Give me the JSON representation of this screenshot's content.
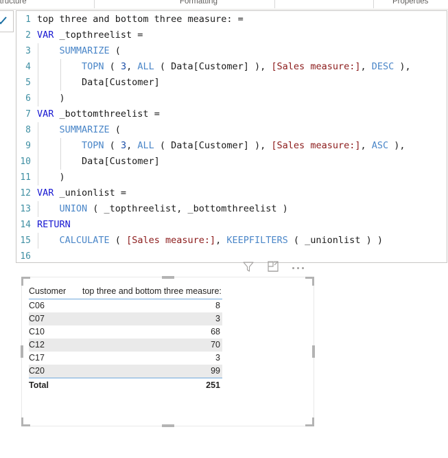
{
  "ribbon": {
    "groups": [
      {
        "name": "structure",
        "label": "Structure"
      },
      {
        "name": "formatting",
        "label": "Formatting"
      },
      {
        "name": "properties",
        "label": "Properties"
      }
    ]
  },
  "formula_bar": {
    "commit_icon": "checkmark-icon",
    "measure_name": "top three and bottom three measure:",
    "lines": [
      {
        "number": "1",
        "indent": 0,
        "tokens": [
          {
            "type": "plain",
            "text": "top three and bottom three measure: ="
          }
        ]
      },
      {
        "number": "2",
        "indent": 0,
        "tokens": [
          {
            "type": "kw",
            "text": "VAR"
          },
          {
            "type": "plain",
            "text": " _topthreelist ="
          }
        ]
      },
      {
        "number": "3",
        "indent": 1,
        "tokens": [
          {
            "type": "plain",
            "text": "    "
          },
          {
            "type": "fn",
            "text": "SUMMARIZE"
          },
          {
            "type": "plain",
            "text": " ("
          }
        ]
      },
      {
        "number": "4",
        "indent": 2,
        "tokens": [
          {
            "type": "plain",
            "text": "        "
          },
          {
            "type": "fn",
            "text": "TOPN"
          },
          {
            "type": "plain",
            "text": " ( "
          },
          {
            "type": "num",
            "text": "3"
          },
          {
            "type": "plain",
            "text": ", "
          },
          {
            "type": "fn",
            "text": "ALL"
          },
          {
            "type": "plain",
            "text": " ( Data[Customer] ), "
          },
          {
            "type": "meas",
            "text": "[Sales measure:]"
          },
          {
            "type": "plain",
            "text": ", "
          },
          {
            "type": "fn",
            "text": "DESC"
          },
          {
            "type": "plain",
            "text": " ),"
          }
        ]
      },
      {
        "number": "5",
        "indent": 2,
        "tokens": [
          {
            "type": "plain",
            "text": "        Data[Customer]"
          }
        ]
      },
      {
        "number": "6",
        "indent": 1,
        "tokens": [
          {
            "type": "plain",
            "text": "    )"
          }
        ]
      },
      {
        "number": "7",
        "indent": 0,
        "tokens": [
          {
            "type": "kw",
            "text": "VAR"
          },
          {
            "type": "plain",
            "text": " _bottomthreelist ="
          }
        ]
      },
      {
        "number": "8",
        "indent": 1,
        "tokens": [
          {
            "type": "plain",
            "text": "    "
          },
          {
            "type": "fn",
            "text": "SUMMARIZE"
          },
          {
            "type": "plain",
            "text": " ("
          }
        ]
      },
      {
        "number": "9",
        "indent": 2,
        "tokens": [
          {
            "type": "plain",
            "text": "        "
          },
          {
            "type": "fn",
            "text": "TOPN"
          },
          {
            "type": "plain",
            "text": " ( "
          },
          {
            "type": "num",
            "text": "3"
          },
          {
            "type": "plain",
            "text": ", "
          },
          {
            "type": "fn",
            "text": "ALL"
          },
          {
            "type": "plain",
            "text": " ( Data[Customer] ), "
          },
          {
            "type": "meas",
            "text": "[Sales measure:]"
          },
          {
            "type": "plain",
            "text": ", "
          },
          {
            "type": "fn",
            "text": "ASC"
          },
          {
            "type": "plain",
            "text": " ),"
          }
        ]
      },
      {
        "number": "10",
        "indent": 2,
        "tokens": [
          {
            "type": "plain",
            "text": "        Data[Customer]"
          }
        ]
      },
      {
        "number": "11",
        "indent": 1,
        "tokens": [
          {
            "type": "plain",
            "text": "    )"
          }
        ]
      },
      {
        "number": "12",
        "indent": 0,
        "tokens": [
          {
            "type": "kw",
            "text": "VAR"
          },
          {
            "type": "plain",
            "text": " _unionlist ="
          }
        ]
      },
      {
        "number": "13",
        "indent": 1,
        "tokens": [
          {
            "type": "plain",
            "text": "    "
          },
          {
            "type": "fn",
            "text": "UNION"
          },
          {
            "type": "plain",
            "text": " ( _topthreelist, _bottomthreelist )"
          }
        ]
      },
      {
        "number": "14",
        "indent": 0,
        "tokens": [
          {
            "type": "kw",
            "text": "RETURN"
          }
        ]
      },
      {
        "number": "15",
        "indent": 1,
        "tokens": [
          {
            "type": "plain",
            "text": "    "
          },
          {
            "type": "fn",
            "text": "CALCULATE"
          },
          {
            "type": "plain",
            "text": " ( "
          },
          {
            "type": "meas",
            "text": "[Sales measure:]"
          },
          {
            "type": "plain",
            "text": ", "
          },
          {
            "type": "fn",
            "text": "KEEPFILTERS"
          },
          {
            "type": "plain",
            "text": " ( _unionlist ) )"
          }
        ]
      },
      {
        "number": "16",
        "indent": 0,
        "tokens": []
      }
    ]
  },
  "visual_header": {
    "icons": [
      {
        "name": "filter-icon",
        "label": "Filters"
      },
      {
        "name": "focus-mode-icon",
        "label": "Focus mode"
      },
      {
        "name": "more-options-icon",
        "label": "More options"
      }
    ]
  },
  "table_visual": {
    "columns": [
      "Customer",
      "top three and bottom three measure:"
    ],
    "rows": [
      {
        "customer": "C06",
        "value": "8"
      },
      {
        "customer": "C07",
        "value": "3"
      },
      {
        "customer": "C10",
        "value": "68"
      },
      {
        "customer": "C12",
        "value": "70"
      },
      {
        "customer": "C17",
        "value": "3"
      },
      {
        "customer": "C20",
        "value": "99"
      }
    ],
    "total": {
      "label": "Total",
      "value": "251"
    }
  },
  "colors": {
    "keyword": "#1717d1",
    "function": "#4a86c8",
    "measure_ref": "#8b1a1a",
    "number_literal": "#1c4fa8",
    "line_number": "#3f8fa3",
    "table_accent": "#6fa8dc",
    "alt_row": "#eaeaea",
    "handle": "#b3b3b3"
  }
}
